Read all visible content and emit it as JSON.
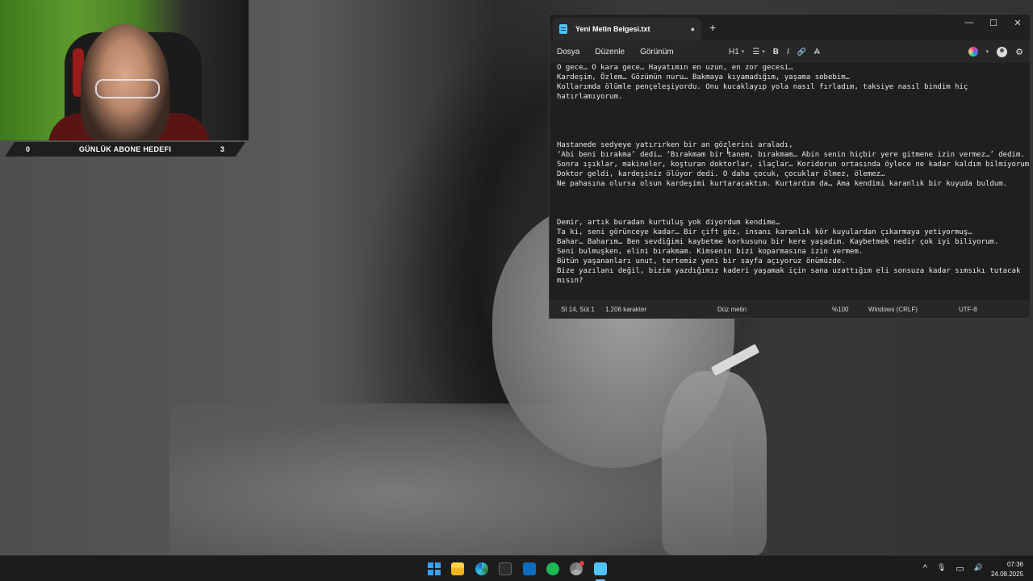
{
  "overlay": {
    "goal_current": "0",
    "goal_title": "GÜNLÜK ABONE HEDEFI",
    "goal_target": "3"
  },
  "notepad": {
    "tab_title": "Yeni Metin Belgesi.txt",
    "unsaved_indicator": "●",
    "new_tab": "+",
    "window_controls": {
      "minimize": "—",
      "maximize": "☐",
      "close": "✕"
    },
    "menu": [
      "Dosya",
      "Düzenle",
      "Görünüm"
    ],
    "toolbar": {
      "heading": "H1",
      "list": "☰",
      "bold": "B",
      "italic": "I",
      "link": "🔗",
      "spell": "A"
    },
    "lines": [
      "O gece… O kara gece… Hayatımın en uzun, en zor gecesi…",
      "Kardeşim, Özlem… Gözümün nuru… Bakmaya kıyamadığım, yaşama sebebim…",
      "Kollarımda ölümle pençeleşiyordu. Onu kucaklayıp yola nasıl fırladım, taksiye nasıl bindim hiç",
      "hatırlamıyorum.",
      "",
      "",
      "",
      "",
      "Hastanede sedyeye yatırırken bir an gözlerini araladı,",
      "‘Abi beni bırakma’ dedi… ‘Bırakmam bir tanem, bırakmam… Abin senin hiçbir yere gitmene izin vermez…’ dedim.",
      "Sonra ışıklar, makineler, koşturan doktorlar, ilaçlar… Koridorun ortasında öylece ne kadar kaldım bilmiyorum.",
      "Doktor geldi, kardeşiniz ölüyor dedi. O daha çocuk, çocuklar ölmez, ölemez…",
      "Ne pahasına olursa olsun kardeşimi kurtaracaktım. Kurtardım da… Ama kendimi karanlık bir kuyuda buldum.",
      "",
      "",
      "",
      "Demir, artık buradan kurtuluş yok diyordum kendime…",
      "Ta ki, seni görünceye kadar… Bir çift göz, insanı karanlık kör kuyulardan çıkarmaya yetiyormuş…",
      "Bahar… Baharım… Ben sevdiğimi kaybetme korkusunu bir kere yaşadım. Kaybetmek nedir çok iyi biliyorum.",
      "Seni bulmuşken, elini bırakmam. Kimsenin bizi koparmasına izin vermem.",
      "Bütün yaşananları unut, tertemiz yeni bir sayfa açıyoruz önümüzde.",
      "Bize yazılanı değil, bizim yazdığımız kaderi yaşamak için sana uzattığım eli sonsuza kadar sımsıkı tutacak",
      "mısın?"
    ],
    "status": {
      "position": "St 14, Süt 1",
      "chars": "1.206 karakter",
      "format": "Düz metin",
      "zoom": "%100",
      "line_ending": "Windows (CRLF)",
      "encoding": "UTF-8"
    }
  },
  "taskbar": {
    "time": "07:36",
    "date": "24.08.2025",
    "tray": {
      "chevron": "^",
      "mic": "🎙",
      "display": "▭",
      "volume": "🔊"
    }
  }
}
